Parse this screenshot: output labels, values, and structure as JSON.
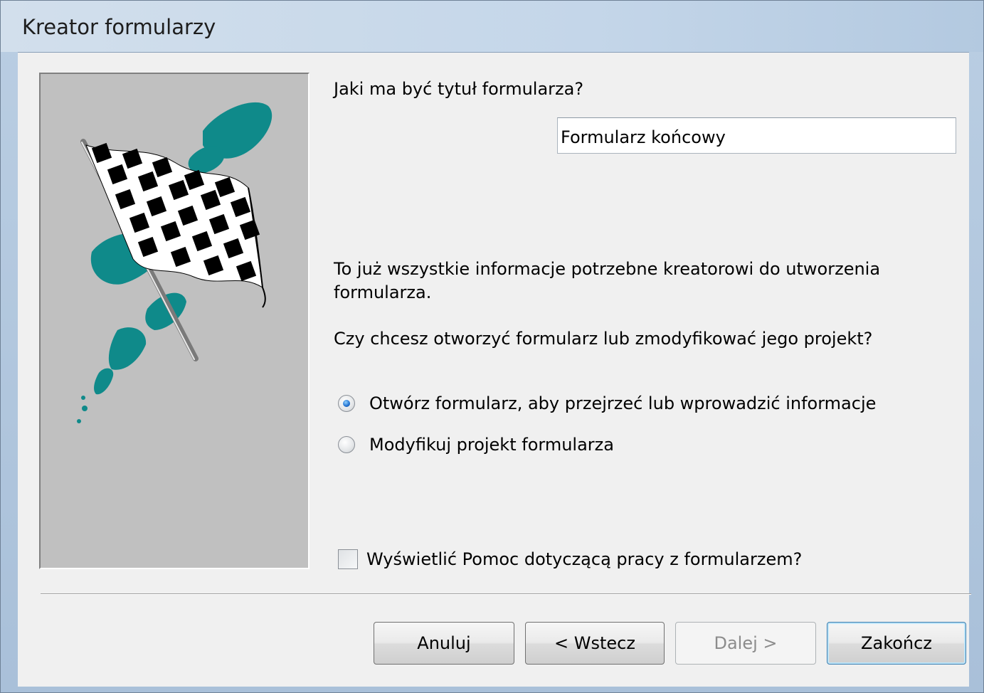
{
  "window": {
    "title": "Kreator formularzy"
  },
  "wizard": {
    "title_question": "Jaki ma być tytuł formularza?",
    "title_value": "Formularz końcowy",
    "info_line1": "To już wszystkie informacje potrzebne kreatorowi do utworzenia",
    "info_line2": "formularza.",
    "open_question": "Czy chcesz otworzyć formularz lub zmodyfikować jego projekt?",
    "options": [
      {
        "label": "Otwórz formularz, aby przejrzeć lub wprowadzić informacje",
        "checked": true
      },
      {
        "label": "Modyfikuj projekt formularza",
        "checked": false
      }
    ],
    "help_checkbox": {
      "label": "Wyświetlić Pomoc dotyczącą pracy z formularzem?",
      "checked": false
    }
  },
  "buttons": {
    "cancel": "Anuluj",
    "back": "< Wstecz",
    "next": "Dalej >",
    "finish": "Zakończ"
  },
  "colors": {
    "accent_teal": "#0f8a8a",
    "radio_blue": "#1f6fcf",
    "default_button_border": "#3c7fb1"
  },
  "icons": {
    "illustration": "checkered-flag-icon"
  }
}
